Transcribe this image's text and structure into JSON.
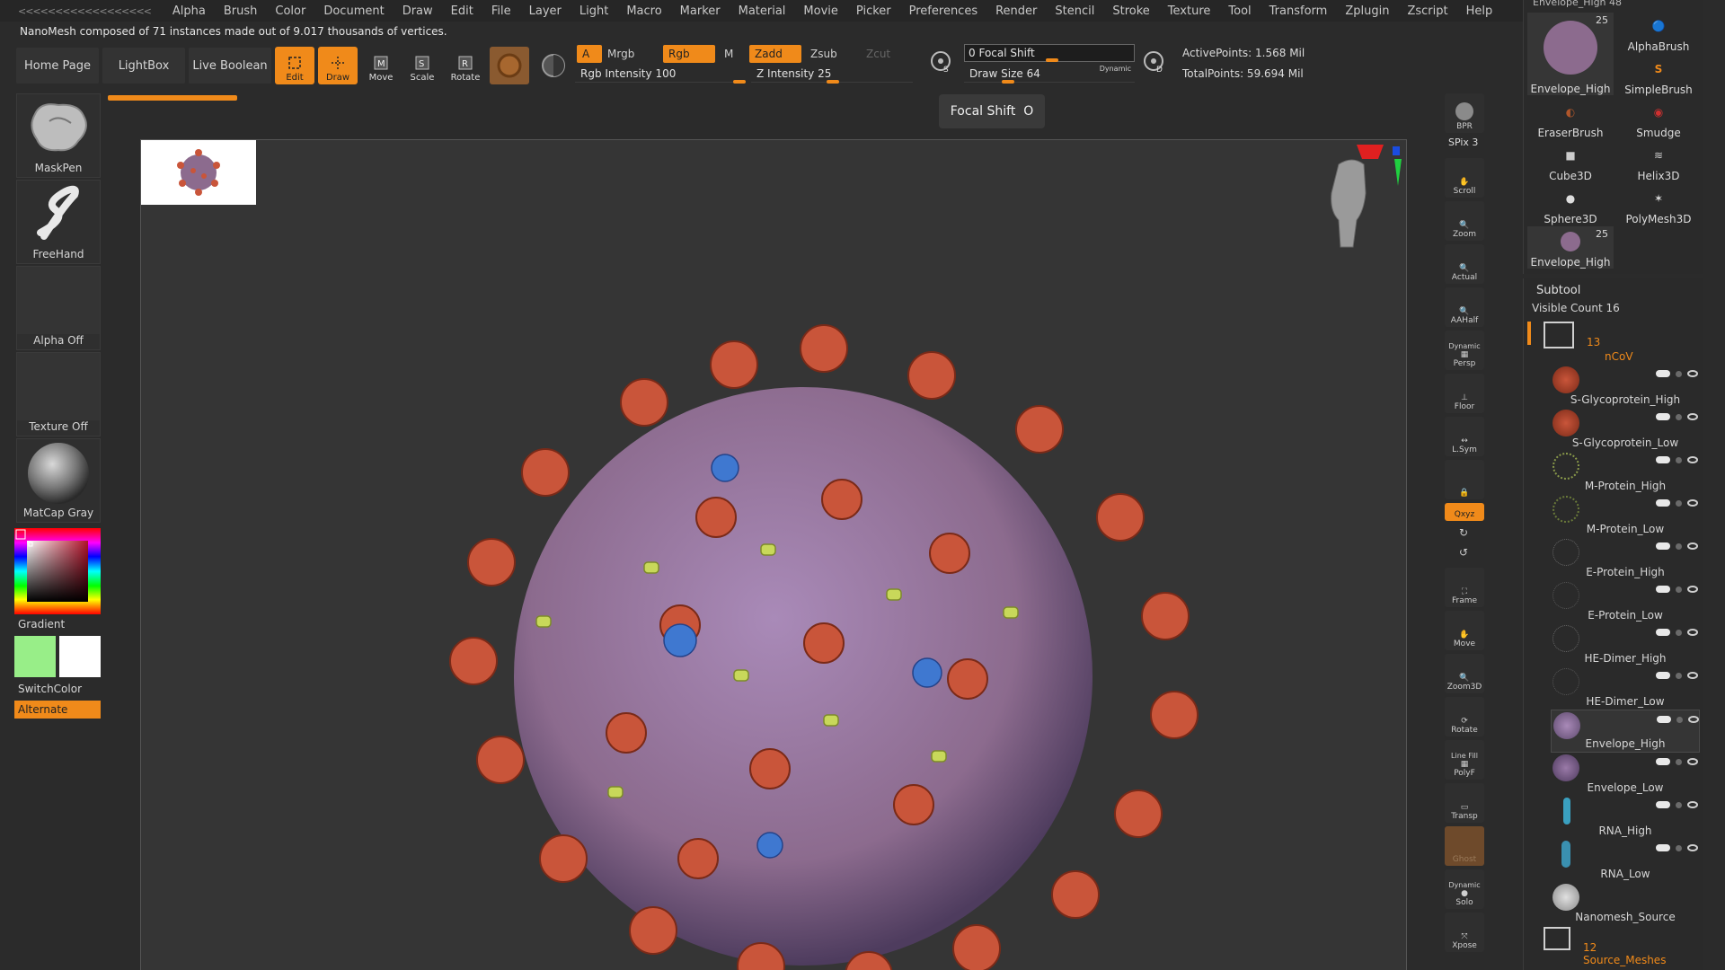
{
  "menubar": {
    "collapse": "<<<<<<<<<<<<<<<<<<",
    "items": [
      "Alpha",
      "Brush",
      "Color",
      "Document",
      "Draw",
      "Edit",
      "File",
      "Layer",
      "Light",
      "Macro",
      "Marker",
      "Material",
      "Movie",
      "Picker",
      "Preferences",
      "Render",
      "Stencil",
      "Stroke",
      "Texture",
      "Tool",
      "Transform",
      "Zplugin",
      "Zscript",
      "Help"
    ]
  },
  "info_line": "NanoMesh composed of 71 instances made out of 9.017 thousands of vertices.",
  "nav": {
    "home": "Home Page",
    "lightbox": "LightBox",
    "live_boolean": "Live Boolean"
  },
  "tools": {
    "edit": "Edit",
    "draw": "Draw",
    "move": "Move",
    "scale": "Scale",
    "rotate": "Rotate"
  },
  "color_modes": {
    "a": "A",
    "mrgb": "Mrgb",
    "rgb": "Rgb",
    "m": "M",
    "zadd": "Zadd",
    "zsub": "Zsub",
    "zcut": "Zcut"
  },
  "rgb_intensity": {
    "label": "Rgb Intensity",
    "value": "100"
  },
  "z_intensity": {
    "label": "Z Intensity",
    "value": "25"
  },
  "focal_shift": {
    "label": "Focal Shift",
    "value": "0"
  },
  "draw_size": {
    "label": "Draw Size",
    "value": "64",
    "dynamic": "Dynamic"
  },
  "stats": {
    "active": "ActivePoints: 1.568 Mil",
    "total": "TotalPoints: 59.694 Mil"
  },
  "tooltip": {
    "label": "Focal Shift",
    "key": "O"
  },
  "left_shelf": {
    "maskpen": "MaskPen",
    "freehand": "FreeHand",
    "alpha_off": "Alpha Off",
    "texture_off": "Texture Off",
    "matcap": "MatCap Gray",
    "gradient": "Gradient",
    "switchcolor": "SwitchColor",
    "alternate": "Alternate"
  },
  "right_shelf": {
    "bpr": "BPR",
    "spix": "SPix 3",
    "scroll": "Scroll",
    "zoom": "Zoom",
    "actual": "Actual",
    "aahalf": "AAHalf",
    "dynamic": "Dynamic",
    "persp": "Persp",
    "floor": "Floor",
    "lsym": "L.Sym",
    "xyz": "Qxyz",
    "frame": "Frame",
    "move": "Move",
    "zoom3d": "Zoom3D",
    "rotate": "Rotate",
    "linefill": "Line Fill",
    "polyf": "PolyF",
    "transp": "Transp",
    "ghost": "Ghost",
    "solo_dynamic": "Dynamic",
    "solo": "Solo",
    "xpose": "Xpose"
  },
  "tool_palette": {
    "header": "Envelope_High 48",
    "envelope_count": "25",
    "items": [
      "Envelope_High",
      "AlphaBrush",
      "SimpleBrush",
      "EraserBrush",
      "Smudge",
      "Cube3D",
      "Helix3D",
      "Sphere3D",
      "PolyMesh3D",
      "Envelope_High"
    ],
    "envelope2_count": "25"
  },
  "subtool": {
    "title": "Subtool",
    "visible_count_label": "Visible Count",
    "visible_count": "16",
    "group_count": "13",
    "group_name": "nCoV",
    "items": [
      "S-Glycoprotein_High",
      "S-Glycoprotein_Low",
      "M-Protein_High",
      "M-Protein_Low",
      "E-Protein_High",
      "E-Protein_Low",
      "HE-Dimer_High",
      "HE-Dimer_Low",
      "Envelope_High",
      "Envelope_Low",
      "RNA_High",
      "RNA_Low",
      "Nanomesh_Source"
    ],
    "folder2_count": "12",
    "folder2_name": "Source_Meshes"
  },
  "colors": {
    "accent": "#f08a1a",
    "main_color": "#98ee88",
    "secondary_color": "#ffffff"
  }
}
